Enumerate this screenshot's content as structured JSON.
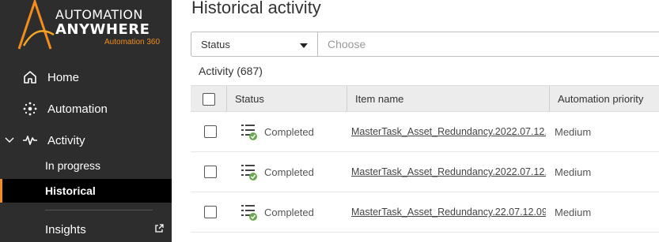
{
  "app": {
    "logo_line1": "AUTOMATION",
    "logo_line2": "ANYWHERE",
    "logo_sub": "Automation 360",
    "brand_color": "#f28c1c"
  },
  "sidebar": {
    "home": "Home",
    "automation": "Automation",
    "activity": "Activity",
    "in_progress": "In progress",
    "historical": "Historical",
    "insights": "Insights"
  },
  "page": {
    "title": "Historical activity"
  },
  "filter": {
    "select_value": "Status",
    "input_placeholder": "Choose"
  },
  "activity_count": "Activity (687)",
  "table": {
    "headers": {
      "status": "Status",
      "item_name": "Item name",
      "priority": "Automation priority"
    },
    "rows": [
      {
        "status": "Completed",
        "item_name": "MasterTask_Asset_Redundancy.2022.07.12....",
        "priority": "Medium"
      },
      {
        "status": "Completed",
        "item_name": "MasterTask_Asset_Redundancy.2022.07.12....",
        "priority": "Medium"
      },
      {
        "status": "Completed",
        "item_name": "MasterTask_Asset_Redundancy.22.07.12.09...",
        "priority": "Medium"
      }
    ]
  },
  "icons": {
    "home": "home-icon",
    "automation": "automation-icon",
    "activity": "activity-pulse-icon",
    "insights_external": "external-link-icon",
    "status_completed": "completed-status-icon"
  }
}
